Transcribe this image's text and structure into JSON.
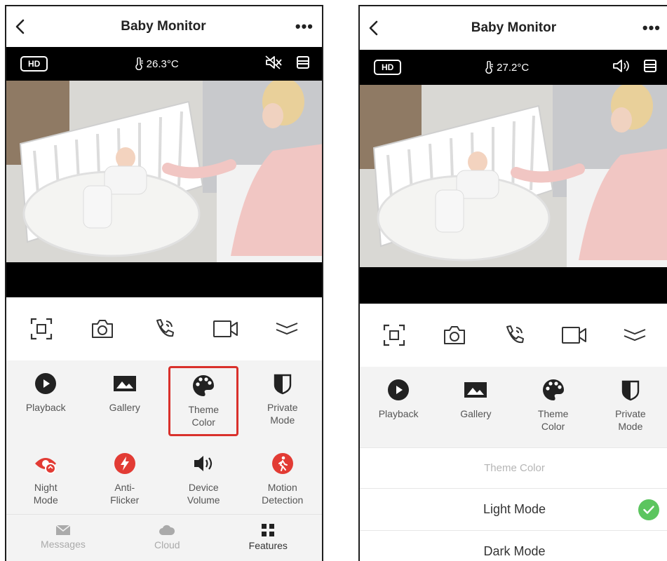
{
  "left_screen": {
    "title": "Baby Monitor",
    "more_label": "•••",
    "hd_badge": "HD",
    "temperature": "26.3°C",
    "features_row1": [
      {
        "label": "Playback"
      },
      {
        "label": "Gallery"
      },
      {
        "label": "Theme\nColor"
      },
      {
        "label": "Private\nMode"
      }
    ],
    "features_row2": [
      {
        "label": "Night\nMode"
      },
      {
        "label": "Anti-\nFlicker"
      },
      {
        "label": "Device\nVolume"
      },
      {
        "label": "Motion\nDetection"
      }
    ],
    "nav": [
      {
        "label": "Messages"
      },
      {
        "label": "Cloud"
      },
      {
        "label": "Features"
      }
    ]
  },
  "right_screen": {
    "title": "Baby Monitor",
    "more_label": "•••",
    "hd_badge": "HD",
    "temperature": "27.2°C",
    "features_row1": [
      {
        "label": "Playback"
      },
      {
        "label": "Gallery"
      },
      {
        "label": "Theme\nColor"
      },
      {
        "label": "Private\nMode"
      }
    ],
    "theme_panel": {
      "heading": "Theme Color",
      "options": [
        {
          "label": "Light Mode"
        },
        {
          "label": "Dark Mode"
        }
      ]
    }
  },
  "colors": {
    "accent_red": "#d9302b",
    "check_green": "#5cc55f",
    "icon_dark": "#222222"
  }
}
